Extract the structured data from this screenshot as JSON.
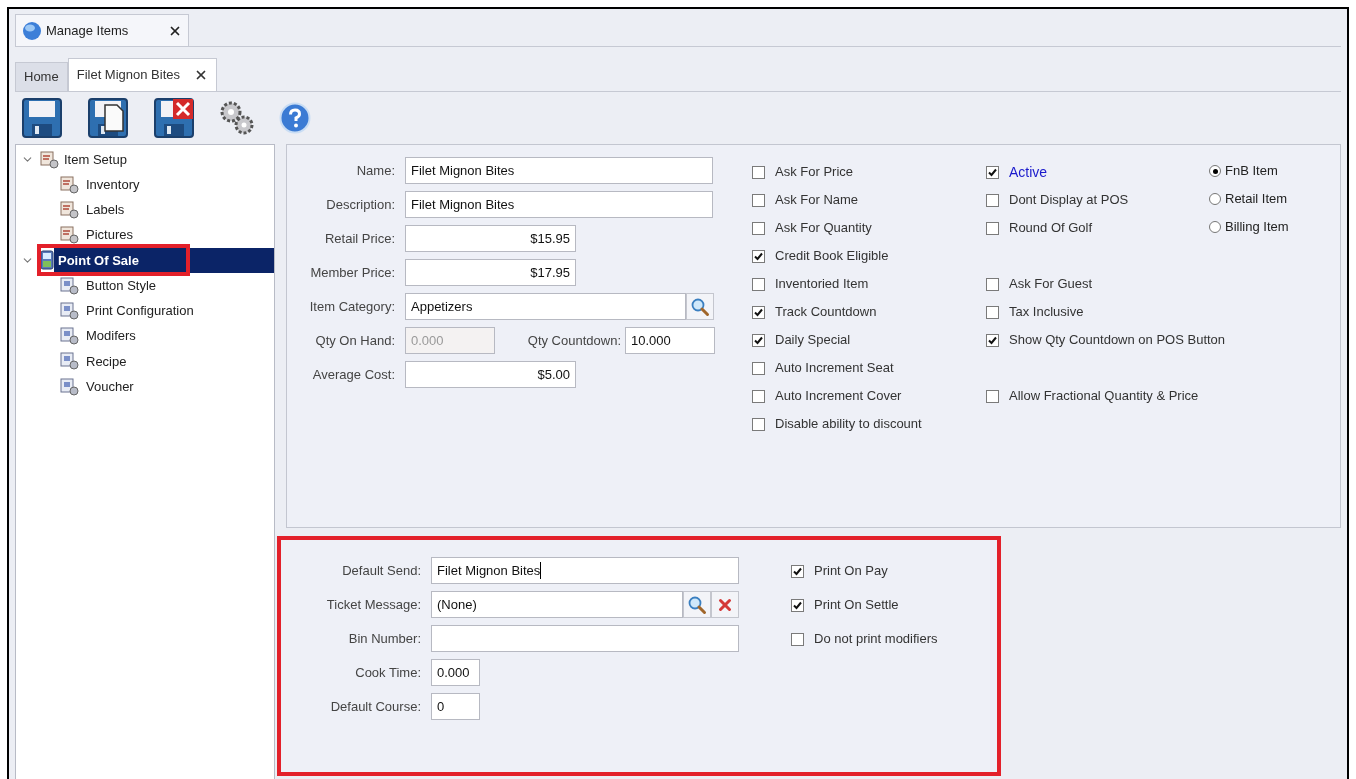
{
  "window_tab": {
    "label": "Manage Items",
    "closable": true
  },
  "doc_tabs": [
    {
      "label": "Home",
      "selected": false,
      "closable": false
    },
    {
      "label": "Filet Mignon Bites",
      "selected": true,
      "closable": true
    }
  ],
  "tree": [
    {
      "label": "Item Setup",
      "expanded": true,
      "selected": false,
      "highlighted": false,
      "children": [
        {
          "label": "Inventory",
          "selected": false
        },
        {
          "label": "Labels",
          "selected": false
        },
        {
          "label": "Pictures",
          "selected": false
        }
      ]
    },
    {
      "label": "Point Of Sale",
      "expanded": true,
      "selected": true,
      "highlighted": true,
      "children": [
        {
          "label": "Button Style",
          "selected": false
        },
        {
          "label": "Print Configuration",
          "selected": false
        },
        {
          "label": "Modifers",
          "selected": false
        },
        {
          "label": "Recipe",
          "selected": false
        },
        {
          "label": "Voucher",
          "selected": false
        }
      ]
    }
  ],
  "item_form": {
    "fields": [
      {
        "kind": "text",
        "label": "Name:",
        "value": "Filet Mignon Bites"
      },
      {
        "kind": "text",
        "label": "Description:",
        "value": "Filet Mignon Bites"
      },
      {
        "kind": "money",
        "label": "Retail Price:",
        "value": "$15.95"
      },
      {
        "kind": "money",
        "label": "Member Price:",
        "value": "$17.95"
      },
      {
        "kind": "lookup",
        "label": "Item Category:",
        "value": "Appetizers"
      },
      {
        "kind": "pair",
        "label": "Qty On Hand:",
        "value": "0.000",
        "disabled": true,
        "second_label": "Qty Countdown:",
        "second_value": "10.000"
      },
      {
        "kind": "money",
        "label": "Average Cost:",
        "value": "$5.00"
      }
    ],
    "checkbox_rows": [
      {
        "left": {
          "label": "Ask For Price",
          "checked": false
        },
        "right": {
          "label": "Active",
          "checked": true,
          "color": "#1a1acc"
        }
      },
      {
        "left": {
          "label": "Ask For Name",
          "checked": false
        },
        "right": {
          "label": "Dont Display at POS",
          "checked": false
        }
      },
      {
        "left": {
          "label": "Ask For Quantity",
          "checked": false
        },
        "right": {
          "label": "Round Of Golf",
          "checked": false
        }
      },
      {
        "left": {
          "label": "Credit Book Eligible",
          "checked": true
        }
      },
      {
        "left": {
          "label": "Inventoried Item",
          "checked": false
        },
        "right": {
          "label": "Ask For Guest",
          "checked": false
        }
      },
      {
        "left": {
          "label": "Track Countdown",
          "checked": true
        },
        "right": {
          "label": "Tax Inclusive",
          "checked": false
        }
      },
      {
        "left": {
          "label": "Daily Special",
          "checked": true
        },
        "right": {
          "label": "Show Qty Countdown on POS Button",
          "checked": true
        }
      },
      {
        "left": {
          "label": "Auto Increment Seat",
          "checked": false
        }
      },
      {
        "left": {
          "label": "Auto Increment Cover",
          "checked": false
        },
        "right": {
          "label": "Allow Fractional Quantity & Price",
          "checked": false
        }
      },
      {
        "left": {
          "label": "Disable ability to discount",
          "checked": false
        }
      }
    ],
    "item_types": [
      {
        "label": "FnB Item",
        "selected": true
      },
      {
        "label": "Retail Item",
        "selected": false
      },
      {
        "label": "Billing Item",
        "selected": false
      }
    ]
  },
  "pos_form": {
    "highlighted": true,
    "fields": [
      {
        "kind": "text",
        "label": "Default Send:",
        "value": "Filet Mignon Bites",
        "focused": true
      },
      {
        "kind": "lookup_clear",
        "label": "Ticket Message:",
        "value": "(None)"
      },
      {
        "kind": "text",
        "label": "Bin Number:"
      },
      {
        "kind": "short",
        "label": "Cook Time:",
        "value": "0.000"
      },
      {
        "kind": "short",
        "label": "Default Course:",
        "value": "0"
      }
    ],
    "checkboxes": [
      {
        "label": "Print On Pay",
        "checked": true
      },
      {
        "label": "Print On Settle",
        "checked": true
      },
      {
        "label": "Do not print modifiers",
        "checked": false
      }
    ]
  }
}
